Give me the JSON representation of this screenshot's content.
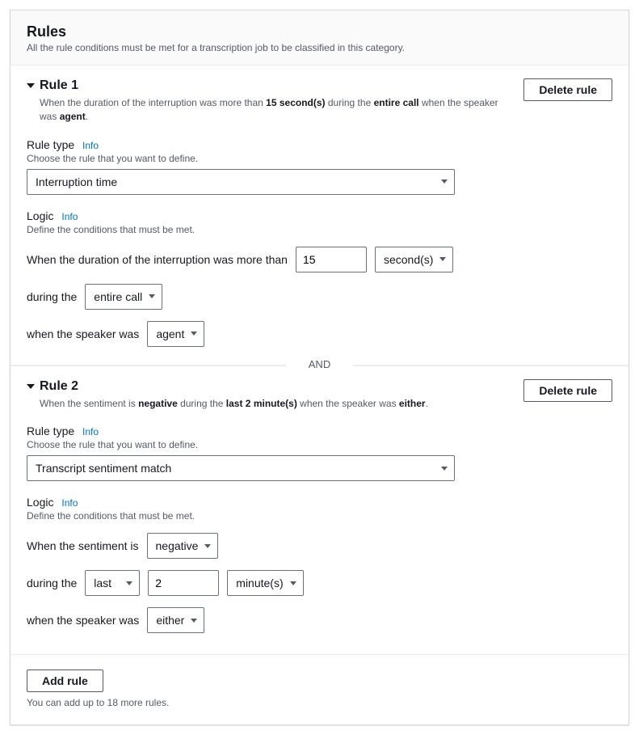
{
  "header": {
    "title": "Rules",
    "subtitle": "All the rule conditions must be met for a transcription job to be classified in this category."
  },
  "labels": {
    "delete_rule": "Delete rule",
    "rule_type": "Rule type",
    "rule_type_desc": "Choose the rule that you want to define.",
    "logic": "Logic",
    "logic_desc": "Define the conditions that must be met.",
    "info": "Info",
    "during_the": "during the",
    "when_speaker": "when the speaker was",
    "and": "AND",
    "add_rule": "Add rule"
  },
  "rule1": {
    "title": "Rule 1",
    "summary_pre": "When the duration of the interruption was more than ",
    "summary_sec": "15 second(s)",
    "summary_mid": " during the ",
    "summary_call": "entire call",
    "summary_mid2": " when the speaker was ",
    "summary_agent": "agent",
    "summary_end": ".",
    "rule_type_value": "Interruption time",
    "logic_prefix": "When the duration of the interruption was more than",
    "duration_value": "15",
    "duration_unit": "second(s)",
    "during_value": "entire call",
    "speaker_value": "agent"
  },
  "rule2": {
    "title": "Rule 2",
    "summary_pre": "When the sentiment is ",
    "summary_neg": "negative",
    "summary_mid": " during the ",
    "summary_last": "last 2 minute(s)",
    "summary_mid2": " when the speaker was ",
    "summary_either": "either",
    "summary_end": ".",
    "rule_type_value": "Transcript sentiment match",
    "logic_prefix": "When the sentiment is",
    "sentiment_value": "negative",
    "during_mode": "last",
    "during_count": "2",
    "during_unit": "minute(s)",
    "speaker_value": "either"
  },
  "footer": {
    "hint": "You can add up to 18 more rules."
  }
}
